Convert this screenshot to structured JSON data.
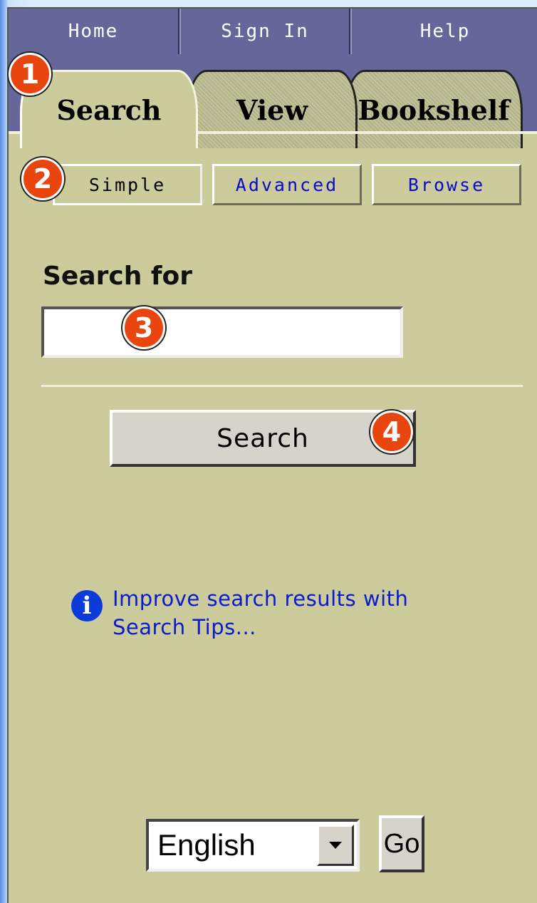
{
  "topnav": {
    "home": "Home",
    "signin": "Sign In",
    "help": "Help"
  },
  "tabs": {
    "search": "Search",
    "view": "View",
    "bookshelf": "Bookshelf"
  },
  "subtabs": {
    "simple": "Simple",
    "advanced": "Advanced",
    "browse": "Browse"
  },
  "search": {
    "label": "Search for",
    "value": "",
    "button": "Search"
  },
  "tips": {
    "icon": "info-icon",
    "line1": "Improve search results with",
    "line2": "Search Tips..."
  },
  "language": {
    "selected": "English",
    "go": "Go"
  },
  "badges": [
    "1",
    "2",
    "3",
    "4"
  ],
  "colors": {
    "panel": "#cbcb9b",
    "nav": "#65679a",
    "link": "#0a0acc",
    "badge": "#e9450f"
  }
}
